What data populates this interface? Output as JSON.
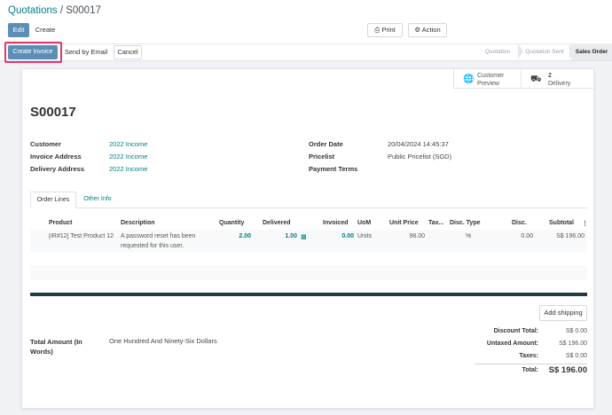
{
  "breadcrumb": {
    "parent": "Quotations",
    "separator": " / ",
    "current": "S00017"
  },
  "toolbar": {
    "edit_label": "Edit",
    "create_label": "Create",
    "print_label": "Print",
    "action_label": "Action"
  },
  "status_buttons": {
    "create_invoice": "Create Invoice",
    "send_by_email": "Send by Email",
    "cancel": "Cancel"
  },
  "stages": [
    {
      "label": "Quotation",
      "active": false
    },
    {
      "label": "Quotation Sent",
      "active": false
    },
    {
      "label": "Sales Order",
      "active": true
    }
  ],
  "smart_buttons": {
    "preview_line1": "Customer",
    "preview_line2": "Preview",
    "delivery_count": "2",
    "delivery_label": "Delivery"
  },
  "order": {
    "name": "S00017",
    "fields_left": [
      {
        "label": "Customer",
        "value": "2022 Income"
      },
      {
        "label": "Invoice Address",
        "value": "2022 Income"
      },
      {
        "label": "Delivery Address",
        "value": "2022 Income"
      }
    ],
    "fields_right": [
      {
        "label": "Order Date",
        "value": "20/04/2024 14:45:37"
      },
      {
        "label": "Pricelist",
        "value": "Public Pricelist (SGD)"
      },
      {
        "label": "Payment Terms",
        "value": ""
      }
    ]
  },
  "tabs": [
    {
      "label": "Order Lines",
      "active": true
    },
    {
      "label": "Other Info",
      "active": false
    }
  ],
  "lines_table": {
    "headers": {
      "product": "Product",
      "description": "Description",
      "quantity": "Quantity",
      "delivered": "Delivered",
      "invoiced": "Invoiced",
      "uom": "UoM",
      "unit_price": "Unit Price",
      "taxes": "Tax...",
      "disc_type": "Disc. Type",
      "disc": "Disc.",
      "subtotal": "Subtotal"
    },
    "rows": [
      {
        "product": "[IR#12] Test Product 12",
        "description_line1": "A password reset has been",
        "description_line2": "requested for this user.",
        "quantity": "2.00",
        "delivered": "1.00",
        "invoiced": "0.00",
        "uom": "Units",
        "unit_price": "98.00",
        "disc_type": "%",
        "disc": "0.00",
        "subtotal": "S$ 196.00"
      }
    ]
  },
  "add_shipping_label": "Add shipping",
  "amount_words": {
    "label_line1": "Total Amount (In",
    "label_line2": "Words)",
    "value": "One Hundred And Ninety-Six Dollars"
  },
  "totals": {
    "discount_label": "Discount Total:",
    "discount_value": "S$ 0.00",
    "untaxed_label": "Untaxed Amount:",
    "untaxed_value": "S$ 196.00",
    "taxes_label": "Taxes:",
    "taxes_value": "S$ 0.00",
    "total_label": "Total:",
    "total_value": "S$ 196.00"
  },
  "colors": {
    "primary": "#5c8fb8",
    "link": "#017e84",
    "highlight_outline": "#e8356e",
    "dark_bar": "#1f3a48"
  }
}
